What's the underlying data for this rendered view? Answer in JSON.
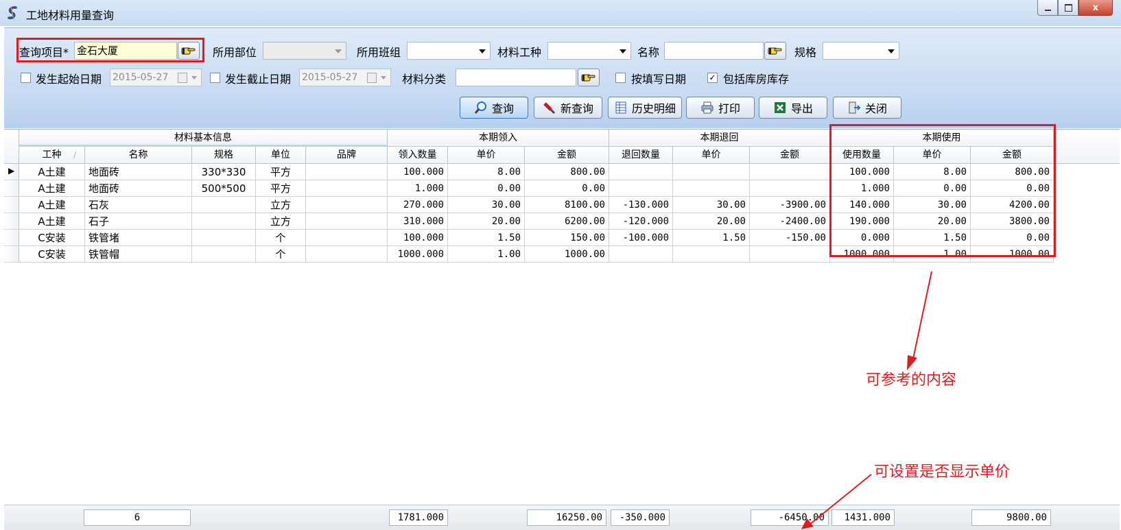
{
  "window": {
    "title": "工地材料用量查询",
    "controls": [
      "minimize",
      "maximize",
      "close"
    ],
    "close_label": "x"
  },
  "filters": {
    "project_label": "查询项目*",
    "project_value": "金石大厦",
    "department_label": "所用部位",
    "team_label": "所用班组",
    "trade_label": "材料工种",
    "name_label": "名称",
    "spec_label": "规格",
    "start_date_label": "发生起始日期",
    "start_date_value": "2015-05-27",
    "end_date_label": "发生截止日期",
    "end_date_value": "2015-05-27",
    "category_label": "材料分类",
    "by_fill_date_label": "按填写日期",
    "by_fill_date_checked": false,
    "include_stock_label": "包括库房库存",
    "include_stock_checked": true,
    "check_mark": "✓"
  },
  "toolbar": {
    "query": "查询",
    "new_query": "新查询",
    "history": "历史明细",
    "print": "打印",
    "export": "导出",
    "close": "关闭"
  },
  "grid": {
    "groups": {
      "basic": "材料基本信息",
      "received": "本期领入",
      "returned": "本期退回",
      "used": "本期使用"
    },
    "columns": {
      "trade": "工种",
      "name": "名称",
      "spec": "规格",
      "unit": "单位",
      "brand": "品牌",
      "recv_qty": "领入数量",
      "recv_price": "单价",
      "recv_amount": "金额",
      "ret_qty": "退回数量",
      "ret_price": "单价",
      "ret_amount": "金额",
      "use_qty": "使用数量",
      "use_price": "单价",
      "use_amount": "金额"
    },
    "sort_indicator": "/",
    "current_row_marker": "▶",
    "rows": [
      {
        "trade": "A土建",
        "name": "地面砖",
        "spec": "330*330",
        "unit": "平方",
        "brand": "",
        "recv_qty": "100.000",
        "recv_price": "8.00",
        "recv_amount": "800.00",
        "ret_qty": "",
        "ret_price": "",
        "ret_amount": "",
        "use_qty": "100.000",
        "use_price": "8.00",
        "use_amount": "800.00"
      },
      {
        "trade": "A土建",
        "name": "地面砖",
        "spec": "500*500",
        "unit": "平方",
        "brand": "",
        "recv_qty": "1.000",
        "recv_price": "0.00",
        "recv_amount": "0.00",
        "ret_qty": "",
        "ret_price": "",
        "ret_amount": "",
        "use_qty": "1.000",
        "use_price": "0.00",
        "use_amount": "0.00"
      },
      {
        "trade": "A土建",
        "name": "石灰",
        "spec": "",
        "unit": "立方",
        "brand": "",
        "recv_qty": "270.000",
        "recv_price": "30.00",
        "recv_amount": "8100.00",
        "ret_qty": "-130.000",
        "ret_price": "30.00",
        "ret_amount": "-3900.00",
        "use_qty": "140.000",
        "use_price": "30.00",
        "use_amount": "4200.00"
      },
      {
        "trade": "A土建",
        "name": "石子",
        "spec": "",
        "unit": "立方",
        "brand": "",
        "recv_qty": "310.000",
        "recv_price": "20.00",
        "recv_amount": "6200.00",
        "ret_qty": "-120.000",
        "ret_price": "20.00",
        "ret_amount": "-2400.00",
        "use_qty": "190.000",
        "use_price": "20.00",
        "use_amount": "3800.00"
      },
      {
        "trade": "C安装",
        "name": "铁管堵",
        "spec": "",
        "unit": "个",
        "brand": "",
        "recv_qty": "100.000",
        "recv_price": "1.50",
        "recv_amount": "150.00",
        "ret_qty": "-100.000",
        "ret_price": "1.50",
        "ret_amount": "-150.00",
        "use_qty": "0.000",
        "use_price": "1.50",
        "use_amount": "0.00"
      },
      {
        "trade": "C安装",
        "name": "铁管帽",
        "spec": "",
        "unit": "个",
        "brand": "",
        "recv_qty": "1000.000",
        "recv_price": "1.00",
        "recv_amount": "1000.00",
        "ret_qty": "",
        "ret_price": "",
        "ret_amount": "",
        "use_qty": "1000.000",
        "use_price": "1.00",
        "use_amount": "1000.00"
      }
    ],
    "footer": {
      "count": "6",
      "recv_qty": "1781.000",
      "recv_amount": "16250.00",
      "ret_qty": "-350.000",
      "ret_amount": "-6450.00",
      "use_qty": "1431.000",
      "use_amount": "9800.00"
    }
  },
  "annotations": {
    "reference": "可参考的内容",
    "unit_price_setting": "可设置是否显示单价"
  },
  "colors": {
    "highlight": "#e4191f",
    "input_yellow": "#ffffd8"
  }
}
